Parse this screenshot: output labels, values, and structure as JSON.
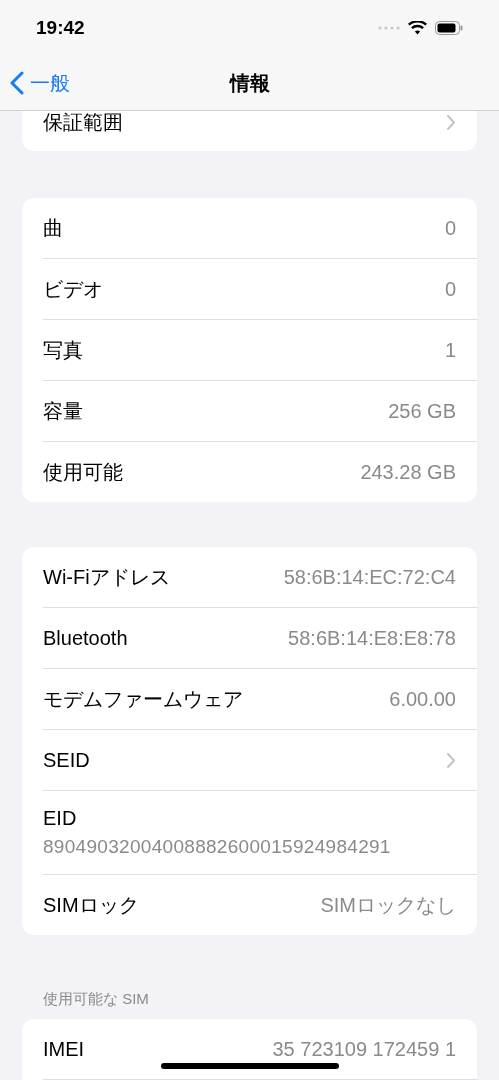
{
  "status_bar": {
    "time": "19:42"
  },
  "nav": {
    "back_label": "一般",
    "title": "情報"
  },
  "sections": [
    {
      "clipped_top": true,
      "rows": [
        {
          "kind": "link",
          "label": "保証範囲"
        }
      ]
    },
    {
      "rows": [
        {
          "kind": "value",
          "label": "曲",
          "value": "0"
        },
        {
          "kind": "value",
          "label": "ビデオ",
          "value": "0"
        },
        {
          "kind": "value",
          "label": "写真",
          "value": "1"
        },
        {
          "kind": "value",
          "label": "容量",
          "value": "256 GB"
        },
        {
          "kind": "value",
          "label": "使用可能",
          "value": "243.28 GB"
        }
      ]
    },
    {
      "rows": [
        {
          "kind": "value",
          "label": "Wi-Fiアドレス",
          "value": "58:6B:14:EC:72:C4"
        },
        {
          "kind": "value",
          "label": "Bluetooth",
          "value": "58:6B:14:E8:E8:78"
        },
        {
          "kind": "value",
          "label": "モデムファームウェア",
          "value": "6.00.00"
        },
        {
          "kind": "link",
          "label": "SEID"
        },
        {
          "kind": "stacked",
          "label": "EID",
          "value": "89049032004008882600015924984291"
        },
        {
          "kind": "value",
          "label": "SIMロック",
          "value": "SIMロックなし"
        }
      ]
    },
    {
      "header": "使用可能な SIM",
      "clipped_bottom": true,
      "rows": [
        {
          "kind": "value",
          "label": "IMEI",
          "value": "35 723109 172459 1"
        }
      ]
    }
  ]
}
